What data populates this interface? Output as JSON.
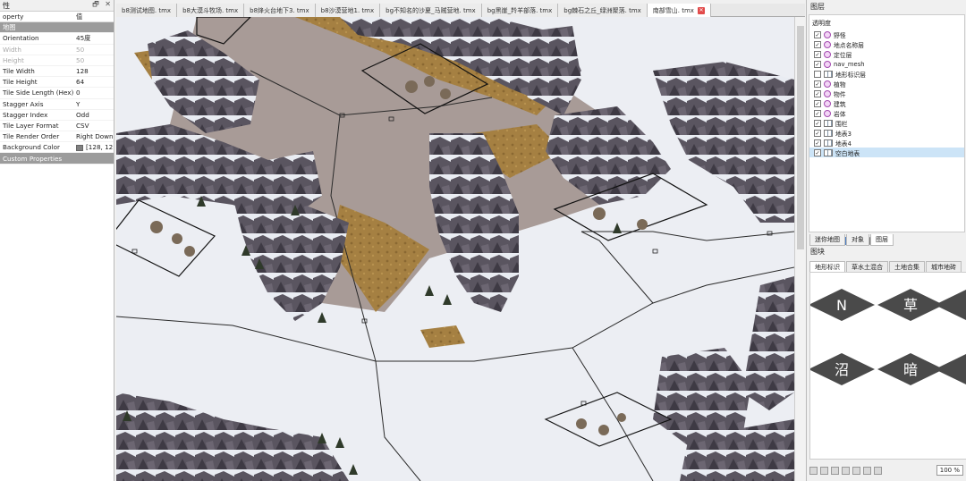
{
  "properties": {
    "header_label": "性",
    "header_buttons": [
      "🗗",
      "✕"
    ],
    "column_property": "operty",
    "column_value": "值",
    "group_map": "地图",
    "rows": [
      {
        "key": "Orientation",
        "value": "45度",
        "disabled": false
      },
      {
        "key": "Width",
        "value": "50",
        "disabled": true
      },
      {
        "key": "Height",
        "value": "50",
        "disabled": true
      },
      {
        "key": "Tile Width",
        "value": "128",
        "disabled": false
      },
      {
        "key": "Tile Height",
        "value": "64",
        "disabled": false
      },
      {
        "key": "Tile Side Length (Hex)",
        "value": "0",
        "disabled": false
      },
      {
        "key": "Stagger Axis",
        "value": "Y",
        "disabled": false
      },
      {
        "key": "Stagger Index",
        "value": "Odd",
        "disabled": false
      },
      {
        "key": "Tile Layer Format",
        "value": "CSV",
        "disabled": false
      },
      {
        "key": "Tile Render Order",
        "value": "Right Down",
        "disabled": false
      }
    ],
    "background_color_label": "Background Color",
    "background_color_value": "[128, 12",
    "group_custom": "Custom Properties"
  },
  "tabs": [
    {
      "label": "b8测试地图. tmx",
      "active": false
    },
    {
      "label": "b8大漠斗牧场. tmx",
      "active": false
    },
    {
      "label": "b8烽火台地下3. tmx",
      "active": false
    },
    {
      "label": "b8沙漠营地1. tmx",
      "active": false
    },
    {
      "label": "bg不知名的沙夏_马贼营地. tmx",
      "active": false
    },
    {
      "label": "bg黑崖_羚羊部落. tmx",
      "active": false
    },
    {
      "label": "bg棘石之丘_绿洲聚落. tmx",
      "active": false
    },
    {
      "label": "南部雪山. tmx",
      "active": true
    }
  ],
  "tab_close": "✕",
  "layers": {
    "title": "图层",
    "opacity_label": "透明度",
    "items": [
      {
        "name": "野怪",
        "kind": "obj",
        "checked": true,
        "selected": false
      },
      {
        "name": "地点名称层",
        "kind": "obj",
        "checked": true,
        "selected": false
      },
      {
        "name": "定位层",
        "kind": "obj",
        "checked": true,
        "selected": false
      },
      {
        "name": "nav_mesh",
        "kind": "obj",
        "checked": true,
        "selected": false
      },
      {
        "name": "地形标识层",
        "kind": "tile",
        "checked": false,
        "selected": false
      },
      {
        "name": "植物",
        "kind": "obj",
        "checked": true,
        "selected": false
      },
      {
        "name": "物件",
        "kind": "obj",
        "checked": true,
        "selected": false
      },
      {
        "name": "建筑",
        "kind": "obj",
        "checked": true,
        "selected": false
      },
      {
        "name": "岩体",
        "kind": "obj",
        "checked": true,
        "selected": false
      },
      {
        "name": "围栏",
        "kind": "tile",
        "checked": true,
        "selected": false
      },
      {
        "name": "地表3",
        "kind": "tile",
        "checked": true,
        "selected": false
      },
      {
        "name": "地表4",
        "kind": "tile",
        "checked": true,
        "selected": false
      },
      {
        "name": "空白地表",
        "kind": "tile",
        "checked": true,
        "selected": true
      }
    ],
    "bottom_tabs": [
      "迷你地图",
      "对象",
      "图层"
    ]
  },
  "tiles": {
    "title": "图块",
    "tabs": [
      "地形标识",
      "草水土混合",
      "土地合集",
      "城市地砖"
    ],
    "glyphs": [
      "N",
      "草",
      "沼",
      "暗"
    ]
  },
  "zoom": "100 %",
  "colors": {
    "snow": "#f1f2f6",
    "dirt": "#a07a3a",
    "road": "#a89a96",
    "rock": "#55505a",
    "selection": "#cce4f7"
  }
}
